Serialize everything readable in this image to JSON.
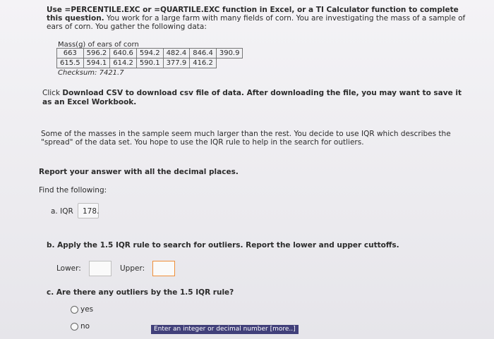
{
  "intro": {
    "bold_text": "Use =PERCENTILE.EXC or =QUARTILE.EXC function in Excel, or a TI Calculator function to complete this question.",
    "rest_text": " You work for a large farm with many fields of corn. You are investigating the mass of a sample of ears of corn. You gather the following data:"
  },
  "table": {
    "title": "Mass(g) of ears of corn",
    "rows": [
      [
        "663",
        "596.2",
        "640.6",
        "594.2",
        "482.4",
        "846.4",
        "390.9"
      ],
      [
        "615.5",
        "594.1",
        "614.2",
        "590.1",
        "377.9",
        "416.2"
      ]
    ],
    "checksum": "Checksum: 7421.7"
  },
  "download": {
    "pre": "Click ",
    "link": "Download CSV",
    "post": " to download csv file of data. After downloading the file, you may want to save it as an Excel Workbook."
  },
  "outlier_text": "Some of the masses in the sample seem much larger than the rest. You decide to use IQR which describes the \"spread\" of the data set. You hope to use the IQR rule to help in the search for outliers.",
  "report_text": "Report your answer with all the decimal places.",
  "find_text": "Find the following:",
  "q_a": {
    "label": "a. IQR",
    "value": "178."
  },
  "q_b": {
    "label": "b. Apply the 1.5 IQR rule to search for outliers. Report the lower and upper cuttoffs.",
    "lower_label": "Lower:",
    "upper_label": "Upper:",
    "lower_value": "",
    "upper_value": "",
    "active_border_color": "#ef8f3a"
  },
  "q_c": {
    "label": "c. Are there any outliers by the 1.5 IQR rule?",
    "options": [
      "yes",
      "no"
    ]
  },
  "hint": "Enter an integer or decimal number [more..]"
}
